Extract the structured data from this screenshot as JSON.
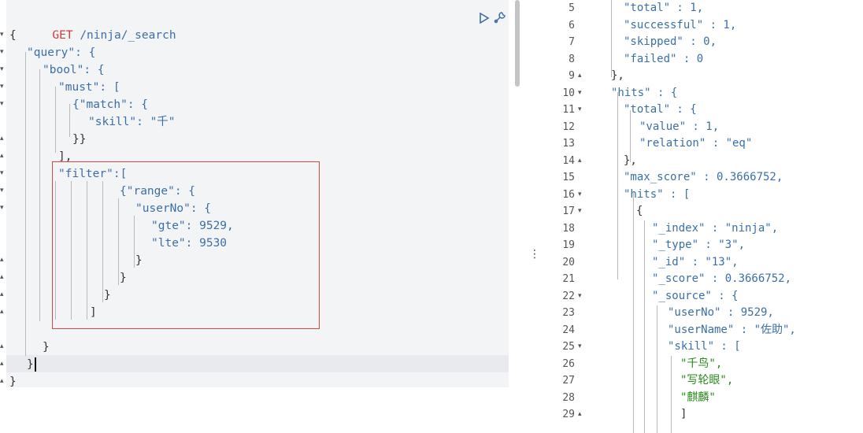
{
  "request": {
    "method": "GET",
    "path": "/ninja/_search",
    "run_icon": "play-icon",
    "settings_icon": "wrench-icon"
  },
  "query_lines": [
    "{",
    "\"query\": {",
    "\"bool\": {",
    "\"must\": [",
    "{\"match\": {",
    "\"skill\": \"千\"",
    "}}",
    "],",
    "\"filter\":[",
    "{\"range\": {",
    "\"userNo\": {",
    "\"gte\": 9529,",
    "\"lte\": 9530",
    "}",
    "}",
    "}",
    "]",
    "}",
    "}",
    "}"
  ],
  "response_lines": [
    {
      "num": "5",
      "text": "\"total\" : 1,"
    },
    {
      "num": "6",
      "text": "\"successful\" : 1,"
    },
    {
      "num": "7",
      "text": "\"skipped\" : 0,"
    },
    {
      "num": "8",
      "text": "\"failed\" : 0"
    },
    {
      "num": "9",
      "text": "},"
    },
    {
      "num": "10",
      "text": "\"hits\" : {"
    },
    {
      "num": "11",
      "text": "\"total\" : {"
    },
    {
      "num": "12",
      "text": "\"value\" : 1,"
    },
    {
      "num": "13",
      "text": "\"relation\" : \"eq\""
    },
    {
      "num": "14",
      "text": "},"
    },
    {
      "num": "15",
      "text": "\"max_score\" : 0.3666752,"
    },
    {
      "num": "16",
      "text": "\"hits\" : ["
    },
    {
      "num": "17",
      "text": "{"
    },
    {
      "num": "18",
      "text": "\"_index\" : \"ninja\","
    },
    {
      "num": "19",
      "text": "\"_type\" : \"3\","
    },
    {
      "num": "20",
      "text": "\"_id\" : \"13\","
    },
    {
      "num": "21",
      "text": "\"_score\" : 0.3666752,"
    },
    {
      "num": "22",
      "text": "\"_source\" : {"
    },
    {
      "num": "23",
      "text": "\"userNo\" : 9529,"
    },
    {
      "num": "24",
      "text": "\"userName\" : \"佐助\","
    },
    {
      "num": "25",
      "text": "\"skill\" : ["
    },
    {
      "num": "26",
      "text": "\"千鸟\","
    },
    {
      "num": "27",
      "text": "\"写轮眼\","
    },
    {
      "num": "28",
      "text": "\"麒麟\""
    },
    {
      "num": "29",
      "text": "]"
    }
  ],
  "colors": {
    "key": "#3a6fa8",
    "string": "#2a8a1e",
    "method": "#c83d3d",
    "highlight_border": "#d64545",
    "active_line": "#e8eaed"
  }
}
